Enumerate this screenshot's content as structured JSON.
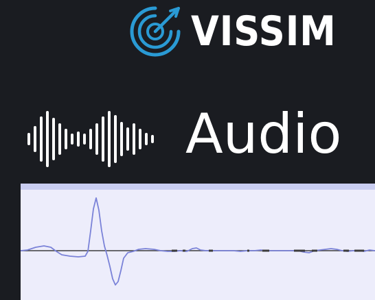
{
  "brand": {
    "name": "VISSIM",
    "accent_color": "#2a9ad4",
    "logo_icon": "target-rings-icon"
  },
  "section": {
    "title": "Audio",
    "icon": "sound-wave-icon"
  },
  "waveform": {
    "background_color": "#ededfb",
    "header_color": "#c9cdf1",
    "trace_color": "#7a82d8",
    "baseline_color": "#3c3c3c"
  }
}
